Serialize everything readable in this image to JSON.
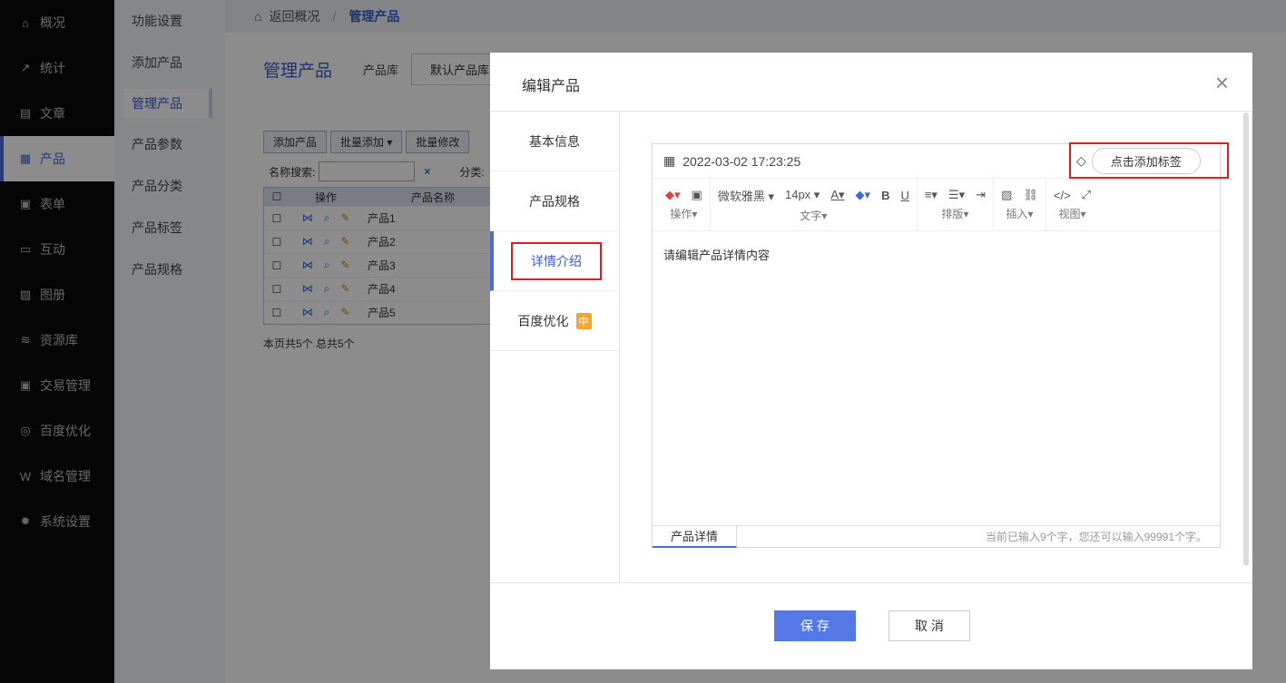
{
  "sidebar": {
    "items": [
      {
        "label": "概况",
        "icon": "home-icon",
        "glyph": "⌂"
      },
      {
        "label": "统计",
        "icon": "chart-icon",
        "glyph": "↗"
      },
      {
        "label": "文章",
        "icon": "document-icon",
        "glyph": "▤"
      },
      {
        "label": "产品",
        "icon": "grid-icon",
        "glyph": "▦",
        "active": true
      },
      {
        "label": "表单",
        "icon": "form-icon",
        "glyph": "▣"
      },
      {
        "label": "互动",
        "icon": "chat-icon",
        "glyph": "▭"
      },
      {
        "label": "图册",
        "icon": "album-icon",
        "glyph": "▨"
      },
      {
        "label": "资源库",
        "icon": "database-icon",
        "glyph": "≋"
      },
      {
        "label": "交易管理",
        "icon": "clipboard-icon",
        "glyph": "▣"
      },
      {
        "label": "百度优化",
        "icon": "target-icon",
        "glyph": "◎"
      },
      {
        "label": "域名管理",
        "icon": "domain-icon",
        "glyph": "W"
      },
      {
        "label": "系统设置",
        "icon": "gear-icon",
        "glyph": "✹"
      }
    ]
  },
  "subnav": {
    "items": [
      "功能设置",
      "添加产品",
      "管理产品",
      "产品参数",
      "产品分类",
      "产品标签",
      "产品规格"
    ],
    "active": "管理产品"
  },
  "breadcrumb": {
    "back": "返回概况",
    "sep": "/",
    "current": "管理产品"
  },
  "page": {
    "title": "管理产品",
    "lib_label": "产品库",
    "lib_value": "默认产品库"
  },
  "toolbar": {
    "add": "添加产品",
    "batch_add": "批量添加",
    "batch_edit": "批量修改"
  },
  "search": {
    "label": "名称搜索:",
    "clear": "×",
    "category_label": "分类:"
  },
  "grid": {
    "headers": {
      "ops": "操作",
      "name": "产品名称"
    },
    "rows": [
      "产品1",
      "产品2",
      "产品3",
      "产品4",
      "产品5"
    ]
  },
  "footer_note": "本页共5个 总共5个",
  "dialog": {
    "title": "编辑产品",
    "close": "×",
    "tabs": [
      {
        "label": "基本信息"
      },
      {
        "label": "产品规格"
      },
      {
        "label": "详情介绍",
        "active": true
      },
      {
        "label": "百度优化",
        "badge": "中"
      }
    ],
    "editor": {
      "datetime": "2022-03-02 17:23:25",
      "tag_button": "点击添加标签",
      "font_family": "微软雅黑",
      "font_size": "14px",
      "groups": [
        "操作",
        "文字",
        "排版",
        "插入",
        "视图"
      ],
      "body_placeholder": "请编辑产品详情内容",
      "foot_tab": "产品详情",
      "counter": "当前已输入9个字，您还可以输入99991个字。"
    },
    "save": "保 存",
    "cancel": "取 消"
  }
}
